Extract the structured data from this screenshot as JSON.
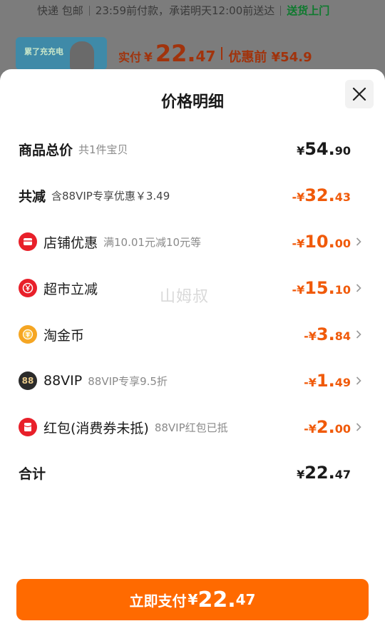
{
  "background": {
    "shipping_label": "快递 包邮",
    "shipping_promise": "23:59前付款，承诺明天12:00前送达",
    "delivery_badge": "送货上门",
    "thumb_text": "累了充充电",
    "paid_label": "实付",
    "paid_symbol": "¥",
    "paid_int": "22.",
    "paid_dec": "47",
    "orig_label": "优惠前 ¥54.9"
  },
  "sheet": {
    "title": "价格明细",
    "close_icon": "close-icon"
  },
  "rows": {
    "total": {
      "label": "商品总价",
      "sub": "共1件宝贝",
      "sym": "¥",
      "int": "54.",
      "dec": "90"
    },
    "discount": {
      "label": "共减",
      "sub": "含88VIP专享优惠￥3.49",
      "sym": "-¥",
      "int": "32.",
      "dec": "43"
    },
    "store": {
      "label": "店铺优惠",
      "sub": "满10.01元减10元等",
      "sym": "-¥",
      "int": "10.",
      "dec": "00",
      "icon": "store-coupon-icon",
      "color": "#e8202a"
    },
    "market": {
      "label": "超市立减",
      "sub": "",
      "sym": "-¥",
      "int": "15.",
      "dec": "10",
      "icon": "supermarket-yen-icon",
      "color": "#e8202a"
    },
    "coin": {
      "label": "淘金币",
      "sub": "",
      "sym": "-¥",
      "int": "3.",
      "dec": "84",
      "icon": "gold-coin-icon",
      "color": "#f5a623"
    },
    "vip": {
      "label": "88VIP",
      "sub": "88VIP专享9.5折",
      "sym": "-¥",
      "int": "1.",
      "dec": "49",
      "icon": "vip-88-icon",
      "icon_text": "88",
      "color": "#2b2b2b"
    },
    "redpack": {
      "label": "红包(消费券未抵)",
      "sub": "88VIP红包已抵",
      "sym": "-¥",
      "int": "2.",
      "dec": "00",
      "icon": "red-packet-icon",
      "color": "#e8202a"
    },
    "sum": {
      "label": "合计",
      "sym": "¥",
      "int": "22.",
      "dec": "47"
    }
  },
  "watermark": "山姆叔",
  "pay_button": {
    "label": "立即支付",
    "sym": "¥",
    "int": "22.",
    "dec": "47"
  },
  "colors": {
    "accent": "#ff6a00",
    "discount": "#f05a0a",
    "icon_red": "#e8202a",
    "coin": "#f5a623"
  }
}
